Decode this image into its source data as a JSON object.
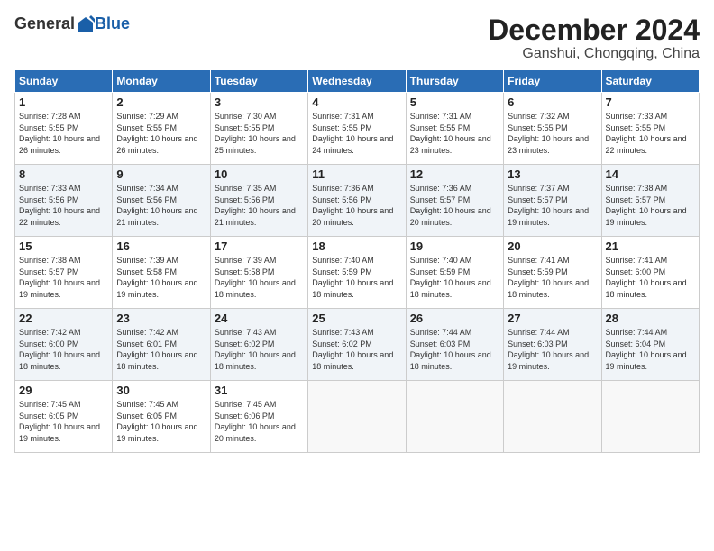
{
  "header": {
    "logo_general": "General",
    "logo_blue": "Blue",
    "title": "December 2024",
    "location": "Ganshui, Chongqing, China"
  },
  "calendar": {
    "days_of_week": [
      "Sunday",
      "Monday",
      "Tuesday",
      "Wednesday",
      "Thursday",
      "Friday",
      "Saturday"
    ],
    "weeks": [
      [
        null,
        null,
        null,
        null,
        {
          "day": 5,
          "sunrise": "7:31 AM",
          "sunset": "5:55 PM",
          "daylight": "10 hours and 23 minutes."
        },
        {
          "day": 6,
          "sunrise": "7:32 AM",
          "sunset": "5:55 PM",
          "daylight": "10 hours and 23 minutes."
        },
        {
          "day": 7,
          "sunrise": "7:33 AM",
          "sunset": "5:55 PM",
          "daylight": "10 hours and 22 minutes."
        }
      ],
      [
        {
          "day": 1,
          "sunrise": "7:28 AM",
          "sunset": "5:55 PM",
          "daylight": "10 hours and 26 minutes."
        },
        {
          "day": 2,
          "sunrise": "7:29 AM",
          "sunset": "5:55 PM",
          "daylight": "10 hours and 26 minutes."
        },
        {
          "day": 3,
          "sunrise": "7:30 AM",
          "sunset": "5:55 PM",
          "daylight": "10 hours and 25 minutes."
        },
        {
          "day": 4,
          "sunrise": "7:31 AM",
          "sunset": "5:55 PM",
          "daylight": "10 hours and 24 minutes."
        },
        {
          "day": 5,
          "sunrise": "7:31 AM",
          "sunset": "5:55 PM",
          "daylight": "10 hours and 23 minutes."
        },
        {
          "day": 6,
          "sunrise": "7:32 AM",
          "sunset": "5:55 PM",
          "daylight": "10 hours and 23 minutes."
        },
        {
          "day": 7,
          "sunrise": "7:33 AM",
          "sunset": "5:55 PM",
          "daylight": "10 hours and 22 minutes."
        }
      ],
      [
        {
          "day": 8,
          "sunrise": "7:33 AM",
          "sunset": "5:56 PM",
          "daylight": "10 hours and 22 minutes."
        },
        {
          "day": 9,
          "sunrise": "7:34 AM",
          "sunset": "5:56 PM",
          "daylight": "10 hours and 21 minutes."
        },
        {
          "day": 10,
          "sunrise": "7:35 AM",
          "sunset": "5:56 PM",
          "daylight": "10 hours and 21 minutes."
        },
        {
          "day": 11,
          "sunrise": "7:36 AM",
          "sunset": "5:56 PM",
          "daylight": "10 hours and 20 minutes."
        },
        {
          "day": 12,
          "sunrise": "7:36 AM",
          "sunset": "5:57 PM",
          "daylight": "10 hours and 20 minutes."
        },
        {
          "day": 13,
          "sunrise": "7:37 AM",
          "sunset": "5:57 PM",
          "daylight": "10 hours and 19 minutes."
        },
        {
          "day": 14,
          "sunrise": "7:38 AM",
          "sunset": "5:57 PM",
          "daylight": "10 hours and 19 minutes."
        }
      ],
      [
        {
          "day": 15,
          "sunrise": "7:38 AM",
          "sunset": "5:57 PM",
          "daylight": "10 hours and 19 minutes."
        },
        {
          "day": 16,
          "sunrise": "7:39 AM",
          "sunset": "5:58 PM",
          "daylight": "10 hours and 19 minutes."
        },
        {
          "day": 17,
          "sunrise": "7:39 AM",
          "sunset": "5:58 PM",
          "daylight": "10 hours and 18 minutes."
        },
        {
          "day": 18,
          "sunrise": "7:40 AM",
          "sunset": "5:59 PM",
          "daylight": "10 hours and 18 minutes."
        },
        {
          "day": 19,
          "sunrise": "7:40 AM",
          "sunset": "5:59 PM",
          "daylight": "10 hours and 18 minutes."
        },
        {
          "day": 20,
          "sunrise": "7:41 AM",
          "sunset": "5:59 PM",
          "daylight": "10 hours and 18 minutes."
        },
        {
          "day": 21,
          "sunrise": "7:41 AM",
          "sunset": "6:00 PM",
          "daylight": "10 hours and 18 minutes."
        }
      ],
      [
        {
          "day": 22,
          "sunrise": "7:42 AM",
          "sunset": "6:00 PM",
          "daylight": "10 hours and 18 minutes."
        },
        {
          "day": 23,
          "sunrise": "7:42 AM",
          "sunset": "6:01 PM",
          "daylight": "10 hours and 18 minutes."
        },
        {
          "day": 24,
          "sunrise": "7:43 AM",
          "sunset": "6:02 PM",
          "daylight": "10 hours and 18 minutes."
        },
        {
          "day": 25,
          "sunrise": "7:43 AM",
          "sunset": "6:02 PM",
          "daylight": "10 hours and 18 minutes."
        },
        {
          "day": 26,
          "sunrise": "7:44 AM",
          "sunset": "6:03 PM",
          "daylight": "10 hours and 18 minutes."
        },
        {
          "day": 27,
          "sunrise": "7:44 AM",
          "sunset": "6:03 PM",
          "daylight": "10 hours and 19 minutes."
        },
        {
          "day": 28,
          "sunrise": "7:44 AM",
          "sunset": "6:04 PM",
          "daylight": "10 hours and 19 minutes."
        }
      ],
      [
        {
          "day": 29,
          "sunrise": "7:45 AM",
          "sunset": "6:05 PM",
          "daylight": "10 hours and 19 minutes."
        },
        {
          "day": 30,
          "sunrise": "7:45 AM",
          "sunset": "6:05 PM",
          "daylight": "10 hours and 19 minutes."
        },
        {
          "day": 31,
          "sunrise": "7:45 AM",
          "sunset": "6:06 PM",
          "daylight": "10 hours and 20 minutes."
        },
        null,
        null,
        null,
        null
      ]
    ]
  }
}
